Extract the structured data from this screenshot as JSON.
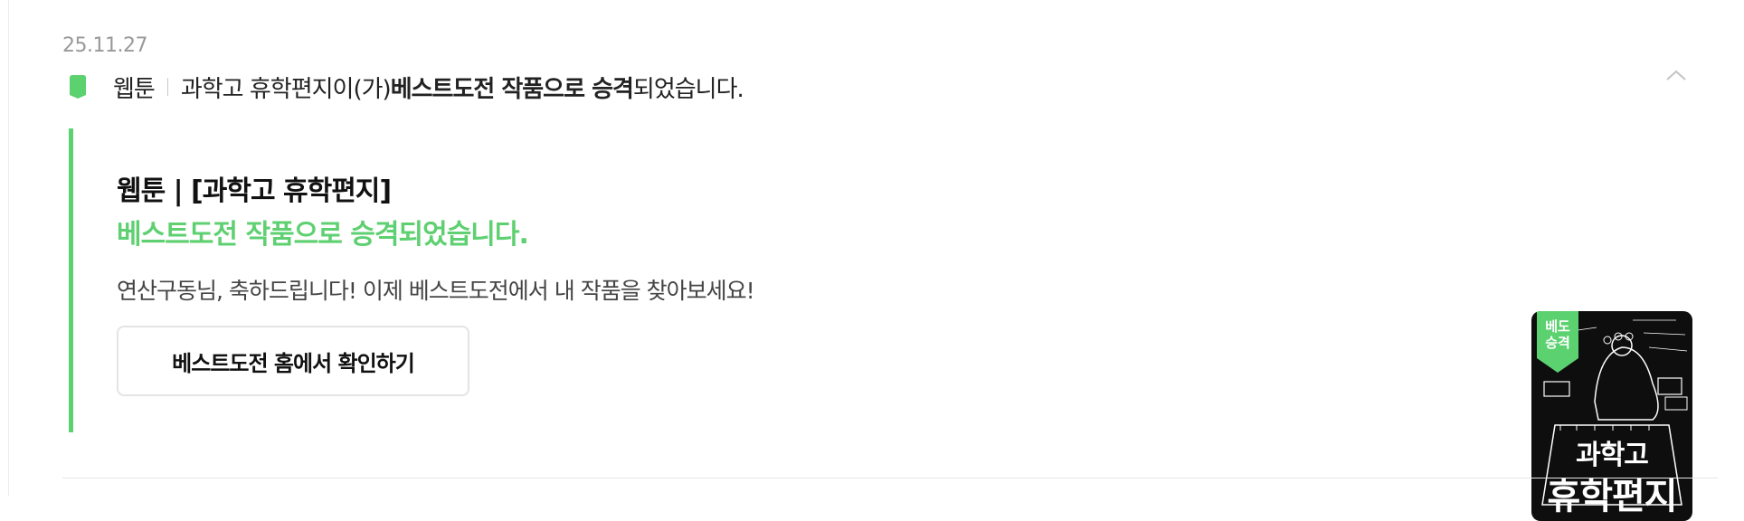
{
  "notification": {
    "date": "25.11.27",
    "category": "웹툰",
    "title_prefix": "과학고 휴학편지이(가) ",
    "title_bold": "베스트도전 작품으로 승격",
    "title_suffix": "되었습니다.",
    "accent_color": "#5bd16f",
    "icons": {
      "marker": "bookmark-icon",
      "collapse": "chevron-up-icon"
    }
  },
  "card": {
    "title": "웹툰 | [과학고 휴학편지]",
    "subtitle": "베스트도전 작품으로 승격되었습니다.",
    "message": "연산구동님, 축하드립니다! 이제 베스트도전에서 내 작품을 찾아보세요!",
    "button_label": "베스트도전 홈에서 확인하기",
    "thumbnail": {
      "badge_line1": "베도",
      "badge_line2": "승격",
      "cover_line1": "과학고",
      "cover_line2": "휴학편지"
    }
  }
}
